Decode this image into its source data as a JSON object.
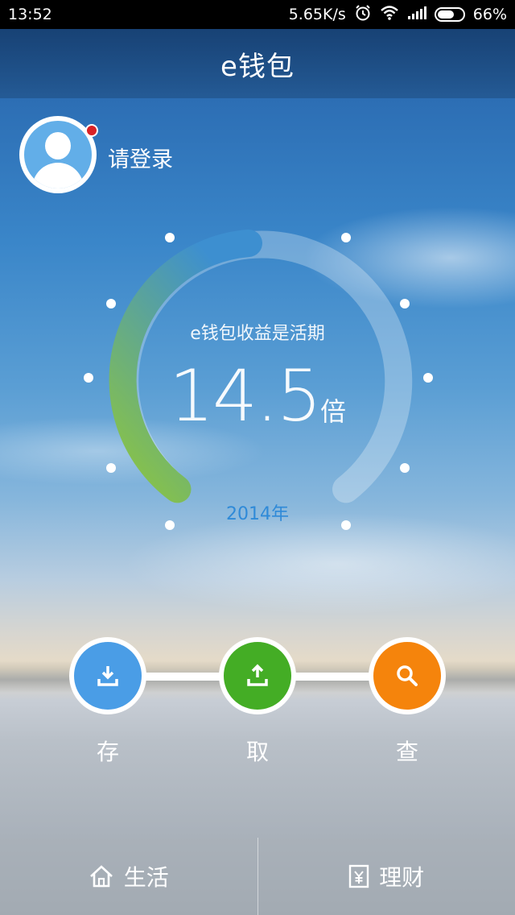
{
  "status_bar": {
    "time": "13:52",
    "network_speed": "5.65K/s",
    "battery": "66%",
    "battery_level": 0.66,
    "icons": [
      "alarm-icon",
      "wifi-icon",
      "signal-icon",
      "battery-icon"
    ]
  },
  "header": {
    "title": "e钱包"
  },
  "user": {
    "login_label": "请登录",
    "notification_color": "#d92226"
  },
  "gauge": {
    "caption": "e钱包收益是活期",
    "value": "14.5",
    "unit": "倍",
    "year": "2014年",
    "accent_colors": [
      "#8dc63f",
      "#3d8fd0"
    ]
  },
  "actions": [
    {
      "label": "存",
      "icon": "download-icon",
      "color": "#4a9de6"
    },
    {
      "label": "取",
      "icon": "upload-icon",
      "color": "#44ad25"
    },
    {
      "label": "查",
      "icon": "search-icon",
      "color": "#f5840c"
    }
  ],
  "bottom_nav": [
    {
      "label": "生活",
      "icon": "home-icon"
    },
    {
      "label": "理财",
      "icon": "finance-icon"
    }
  ]
}
